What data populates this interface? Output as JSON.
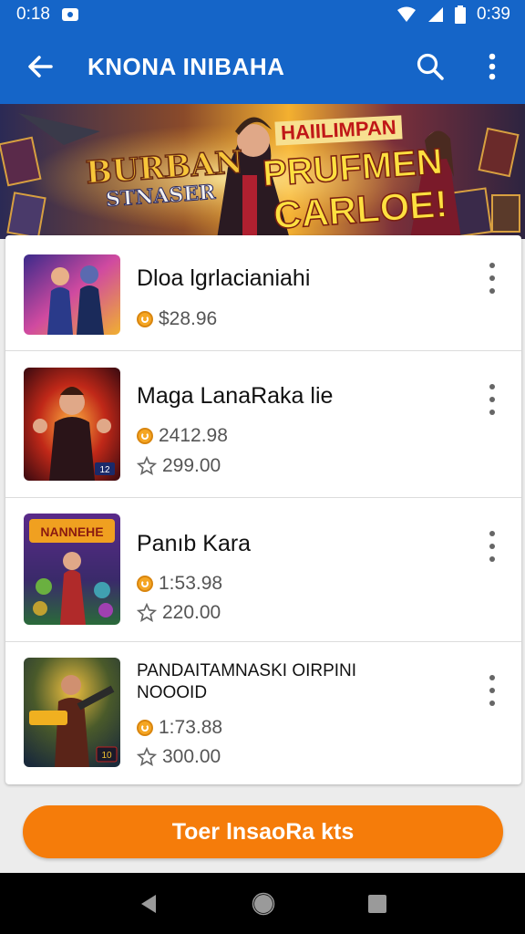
{
  "status": {
    "left_time": "0:18",
    "right_time": "0:39"
  },
  "appbar": {
    "title": "KNONA INIBAHA"
  },
  "banner": {
    "left_line1": "BURBAN",
    "left_line2": "STNASER",
    "right_small": "HAIILIMPAN",
    "right_line1": "PRUFMEN",
    "right_line2": "CARLOE!"
  },
  "items": [
    {
      "title": "Dloa lgrlacianiahi",
      "price": "$28.96",
      "rating": null,
      "thumb_caption": ""
    },
    {
      "title": "Maga LanaRaka lie",
      "price": "2412.98",
      "rating": "299.00",
      "thumb_caption": "12"
    },
    {
      "title": "Panıb Kara",
      "price": "1:53.98",
      "rating": "220.00",
      "thumb_caption": "NANNEHE"
    },
    {
      "title": "PANDAITAMNASKI OIRPINI NOOOID",
      "price": "1:73.88",
      "rating": "300.00",
      "thumb_caption": "10"
    }
  ],
  "cta": {
    "label": "Toer lnsaoRa kts"
  },
  "colors": {
    "primary": "#1565c8",
    "accent": "#f57c0a"
  }
}
